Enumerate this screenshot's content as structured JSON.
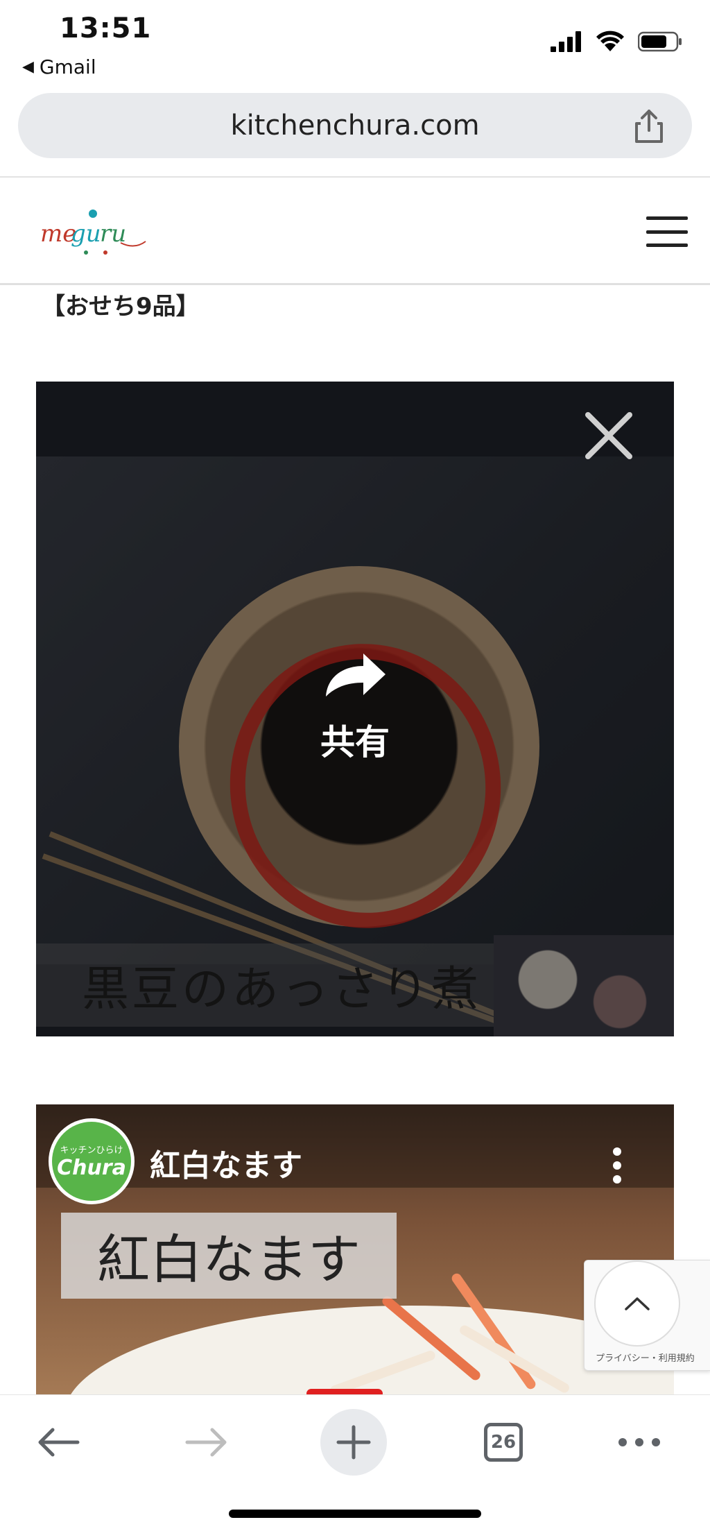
{
  "status_bar": {
    "time": "13:51",
    "back_app": "Gmail"
  },
  "browser": {
    "url": "kitchenchura.com",
    "tab_count": "26"
  },
  "site": {
    "logo_text": "meguru",
    "section_heading": "【おせち9品】"
  },
  "video1": {
    "title_in_video": "黒豆のあっさり煮",
    "share_label": "共有"
  },
  "video2": {
    "channel_avatar_top": "キッチンひらけ",
    "channel_avatar_main": "Chura",
    "header_title": "紅白なます",
    "title_in_video": "紅白なます"
  },
  "recaptcha": {
    "text": "プライバシー・利用規約"
  },
  "colors": {
    "url_bar_bg": "#e8eaed",
    "accent_red": "#c8281e",
    "avatar_green": "#58b449",
    "toolbar_icon": "#5f6368"
  },
  "icons": {
    "share": "share-icon",
    "menu": "hamburger-menu-icon",
    "close": "close-icon",
    "share_arrow": "share-arrow-icon",
    "more": "more-vertical-icon",
    "scroll_top": "chevron-up-icon",
    "back": "arrow-left-icon",
    "forward": "arrow-right-icon",
    "new_tab": "plus-icon",
    "tabs": "tabs-icon",
    "overflow": "more-horizontal-icon"
  }
}
